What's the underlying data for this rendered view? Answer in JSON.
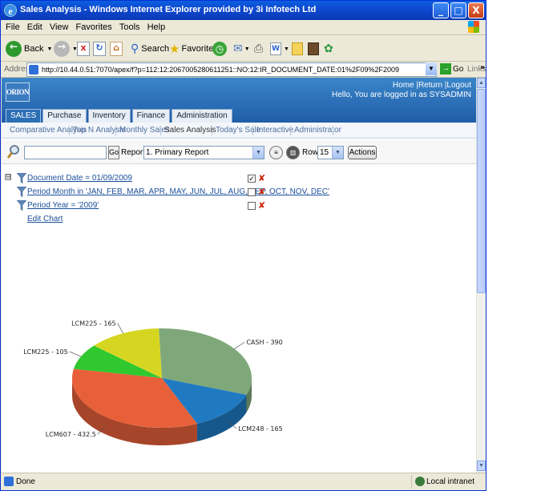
{
  "window": {
    "title": "Sales Analysis - Windows Internet Explorer provided by 3i Infotech Ltd",
    "minimize": "_",
    "maximize": "□",
    "close": "X"
  },
  "menu": [
    "File",
    "Edit",
    "View",
    "Favorites",
    "Tools",
    "Help"
  ],
  "toolbar": {
    "back": "Back",
    "search": "Search",
    "favorites": "Favorites"
  },
  "address": {
    "label": "Address",
    "url": "http://10.44.0.51:7070/apex/f?p=112:12:2067005280611251::NO:12:IR_DOCUMENT_DATE:01%2F09%2F2009",
    "go": "Go",
    "links": "Links",
    "more": "»"
  },
  "app": {
    "logo": "ORION",
    "links": {
      "home": "Home",
      "return": "Return",
      "logout": "Logout",
      "sep": "|"
    },
    "hello": "Hello, You are logged in as SYSADMIN",
    "tabs": [
      "SALES",
      "Purchase",
      "Inventory",
      "Finance",
      "Administration"
    ],
    "subtabs": [
      "Comparative Analysis",
      "Top N Analysis",
      "Monthly Sales",
      "Sales Analysis",
      "Today's Sale",
      "Interactive",
      "Administrator"
    ]
  },
  "search": {
    "value": "",
    "go": "Go",
    "reports_label": "Reports",
    "report_selected": "1. Primary Report",
    "rows_label": "Rows",
    "rows_selected": "15",
    "actions": "Actions"
  },
  "filters": [
    {
      "text": "Document Date = 01/09/2009",
      "checked": true
    },
    {
      "text": "Period Month in 'JAN, FEB, MAR, APR, MAY, JUN, JUL, AUG, SEP, OCT, NOV, DEC'",
      "checked": false
    },
    {
      "text": "Period Year = '2009'",
      "checked": false
    }
  ],
  "collapse_symbol": "⊟",
  "edit_chart": "Edit Chart",
  "chart_data": {
    "type": "pie",
    "slices": [
      {
        "label": "CASH - 390",
        "name": "CASH",
        "value": 390,
        "color": "#7fa87a"
      },
      {
        "label": "LCM248 - 165",
        "name": "LCM248",
        "value": 165,
        "color": "#1f7ac2"
      },
      {
        "label": "LCM607 - 432.5",
        "name": "LCM607",
        "value": 432.5,
        "color": "#e8603a"
      },
      {
        "label": "LCM225 - 105",
        "name": "LCM225",
        "value": 105,
        "color": "#2fc82f"
      },
      {
        "label": "LCM225 - 165",
        "name": "LCM225",
        "value": 165,
        "color": "#d6d622"
      }
    ],
    "style": "3d"
  },
  "status": {
    "text": "Done",
    "zone": "Local intranet"
  }
}
